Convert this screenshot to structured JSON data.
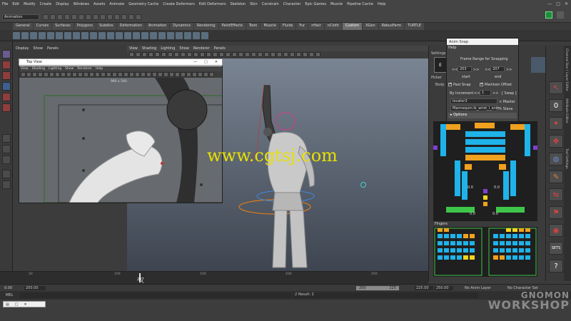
{
  "app": {
    "menus": [
      "File",
      "Edit",
      "Modify",
      "Create",
      "Display",
      "Windows",
      "Assets",
      "Animate",
      "Geometry Cache",
      "Create Deformers",
      "Edit Deformers",
      "Skeleton",
      "Skin",
      "Constrain",
      "Character",
      "Epic Games",
      "Muscle",
      "Pipeline Cache",
      "Help"
    ],
    "mode": "Animation",
    "window_controls": [
      "—",
      "□",
      "✕"
    ]
  },
  "shelf": {
    "tabs": [
      "General",
      "Curves",
      "Surfaces",
      "Polygons",
      "Subdivs",
      "Deformation",
      "Animation",
      "Dynamics",
      "Rendering",
      "PaintEffects",
      "Toon",
      "Muscle",
      "Fluids",
      "Fur",
      "nHair",
      "nCloth",
      "Custom",
      "XGen",
      "RebusFarm",
      "TURTLE"
    ],
    "active_tab": "Custom"
  },
  "outliner": {
    "menus": [
      "Display",
      "Show",
      "Panels"
    ]
  },
  "viewport": {
    "menus": [
      "View",
      "Shading",
      "Lighting",
      "Show",
      "Renderer",
      "Panels"
    ]
  },
  "top_view": {
    "title": "Top View",
    "menus": [
      "View",
      "Shading",
      "Lighting",
      "Show",
      "Renderer",
      "Help"
    ],
    "resolution": "960 x 540",
    "close": "✕",
    "maximize": "□",
    "minimize": "—"
  },
  "watermark": "www.cgtsj.com",
  "anim_snap": {
    "title": "Anim Snap",
    "help": "Help",
    "heading": "Frame Range for Snapping",
    "start_value": "203",
    "end_value": "207",
    "start_label": "start",
    "end_label": "end",
    "prev_btn": "<<",
    "next_btn": ">>",
    "past_snap": "Past Snap",
    "maintain_offset": "Maintain Offset",
    "increment_label": "By Increment",
    "increment_value": "1",
    "snap_btn": "[ Swap ]",
    "master_field": "locator3",
    "master_label": "< Master",
    "slave_field": "Mannequin:ik_wrist_l_anim",
    "slave_label": "< Slave",
    "options": "Options"
  },
  "picker": {
    "settings_label": "Settings",
    "picker_tab": "Picker",
    "body_tab": "Body",
    "fingers_label": "Fingers",
    "left_value": "0.0",
    "right_value": "0.0",
    "left_value2": "0.0",
    "right_value2": "0.0"
  },
  "right_tools": {
    "zero": "0",
    "sets": "SETS",
    "help": "?"
  },
  "side_tabs": [
    "Channel Box / Layer Editor",
    "Attribute Editor",
    "Tool Settings"
  ],
  "timeline": {
    "current_frame": "207",
    "ticks": [
      "50",
      "100",
      "150",
      "200",
      "250"
    ]
  },
  "range": {
    "start": "0.00",
    "range_start": "200.00",
    "inner_start": "200",
    "inner_end": "225",
    "range_end": "225.00",
    "end": "250.00",
    "anim_layer": "No Anim Layer",
    "character_set": "No Character Set"
  },
  "command": {
    "lang": "MEL",
    "result": "// Result: 2"
  },
  "branding": {
    "line1": "GNOMON",
    "line2": "WORKSHOP"
  },
  "colors": {
    "blue": "#1fb3ea",
    "orange": "#f0a11f",
    "yellow": "#f5d41f",
    "purple": "#7e3fd4",
    "green": "#3ec64a",
    "watermark": "#e8e000"
  }
}
